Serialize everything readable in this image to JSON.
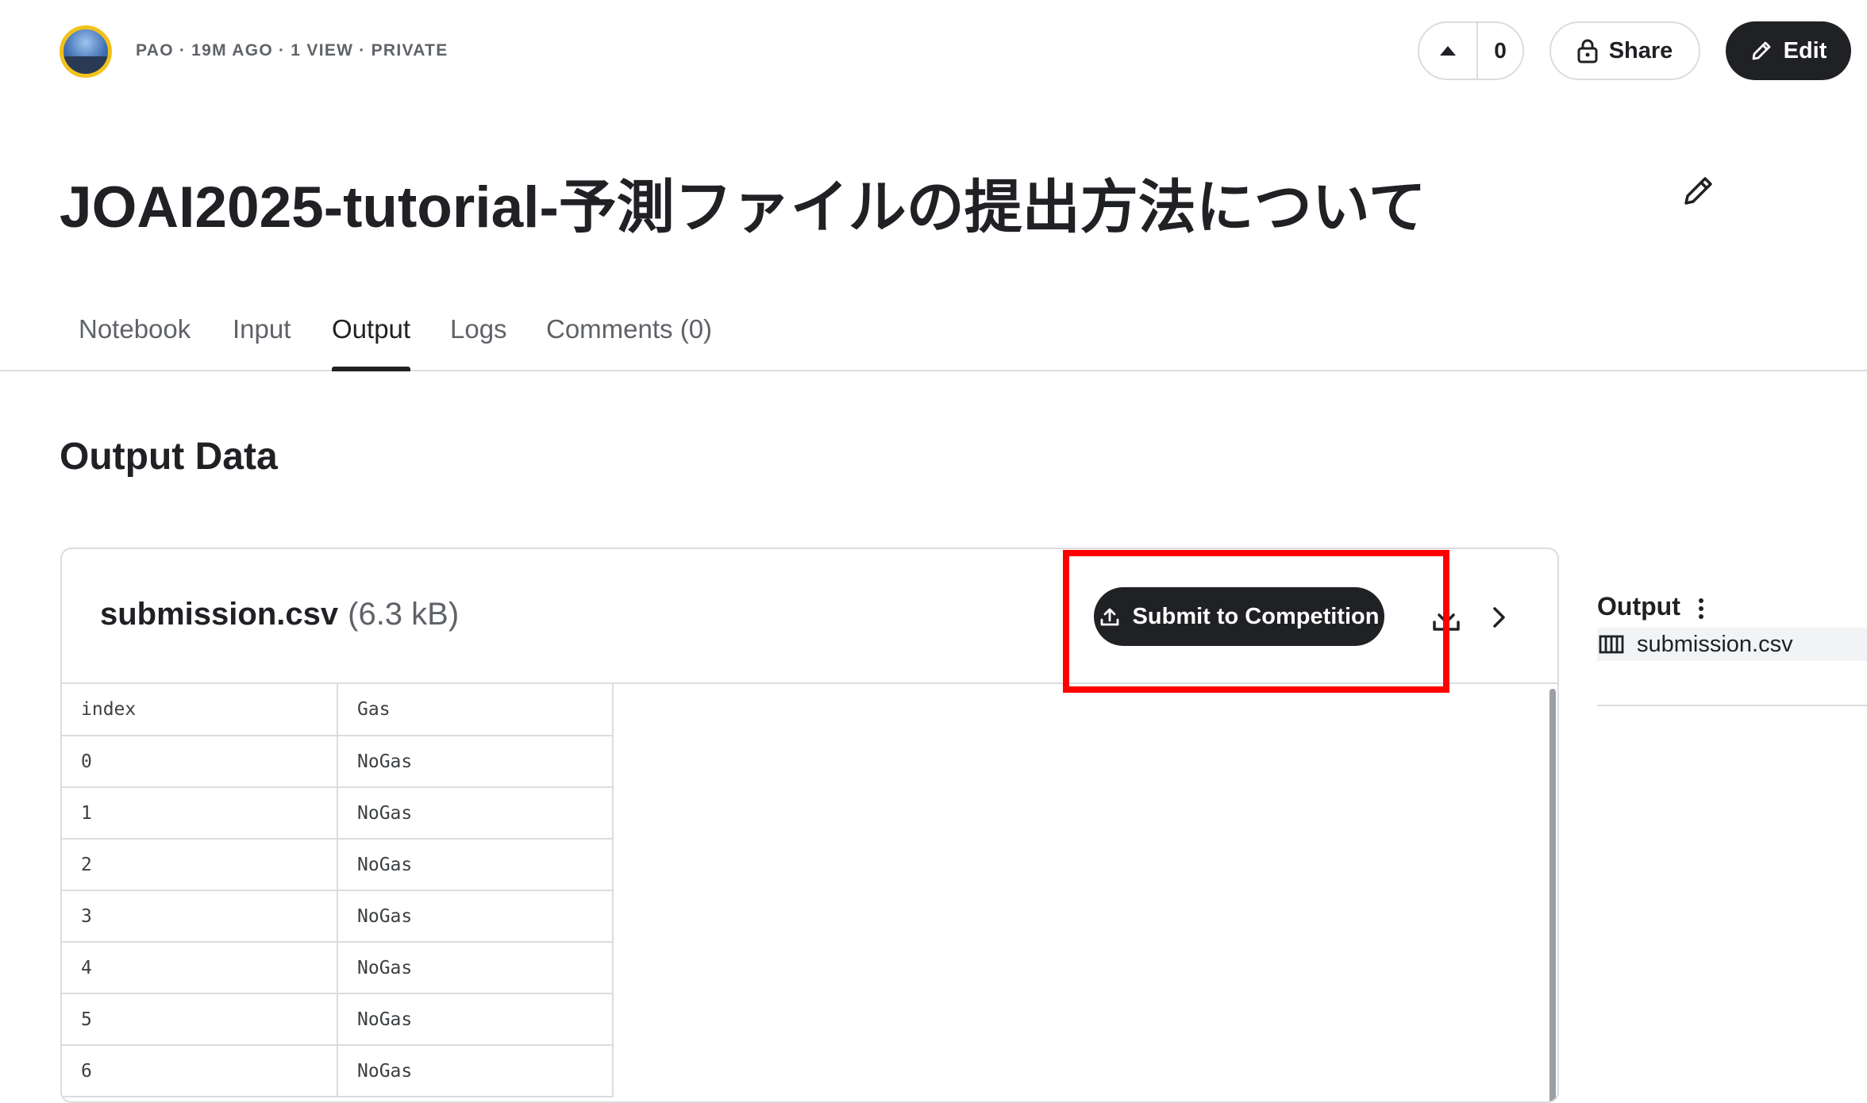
{
  "header": {
    "meta": {
      "author": "PAO",
      "time": "19M AGO",
      "views": "1 VIEW",
      "visibility": "PRIVATE",
      "separator": "·"
    },
    "vote_count": "0",
    "share_label": "Share",
    "edit_label": "Edit"
  },
  "notebook": {
    "title": "JOAI2025-tutorial-予測ファイルの提出方法について"
  },
  "tabs": [
    {
      "label": "Notebook",
      "active": false
    },
    {
      "label": "Input",
      "active": false
    },
    {
      "label": "Output",
      "active": true
    },
    {
      "label": "Logs",
      "active": false
    },
    {
      "label": "Comments (0)",
      "active": false
    }
  ],
  "output": {
    "section_title": "Output Data",
    "file": {
      "name": "submission.csv",
      "size": "(6.3 kB)",
      "submit_label": "Submit to Competition"
    },
    "table": {
      "columns": [
        "index",
        "Gas"
      ],
      "rows": [
        [
          "0",
          "NoGas"
        ],
        [
          "1",
          "NoGas"
        ],
        [
          "2",
          "NoGas"
        ],
        [
          "3",
          "NoGas"
        ],
        [
          "4",
          "NoGas"
        ],
        [
          "5",
          "NoGas"
        ],
        [
          "6",
          "NoGas"
        ]
      ]
    }
  },
  "sidebar": {
    "title": "Output",
    "items": [
      {
        "label": "submission.csv",
        "icon": "table-icon"
      }
    ]
  },
  "colors": {
    "highlight": "#ff0000",
    "primary_dark": "#202124",
    "avatar_ring": "#f2c21b"
  }
}
